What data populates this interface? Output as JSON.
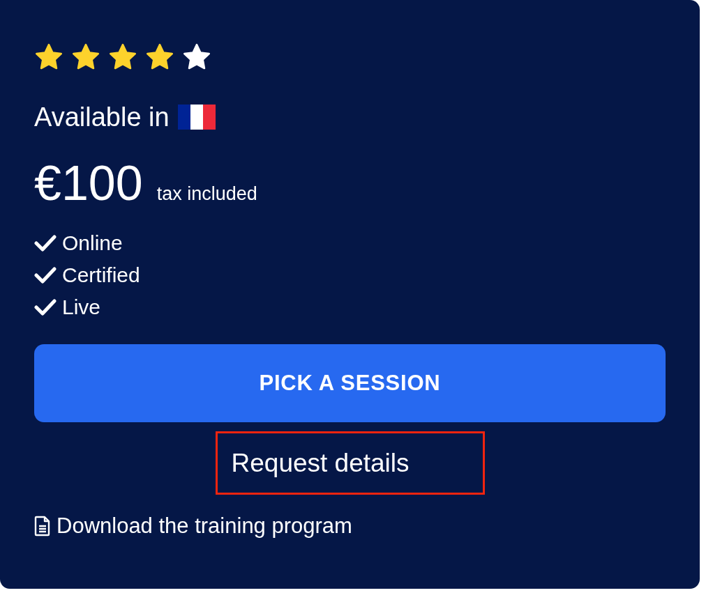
{
  "rating": {
    "stars": 4
  },
  "availability": {
    "label": "Available in"
  },
  "price": {
    "amount": "€100",
    "note": "tax included"
  },
  "features": [
    "Online",
    "Certified",
    "Live"
  ],
  "primary_button": {
    "label": "PICK A SESSION"
  },
  "request_link": {
    "label": "Request details",
    "highlighted": true
  },
  "download_link": {
    "label": "Download the training program"
  }
}
